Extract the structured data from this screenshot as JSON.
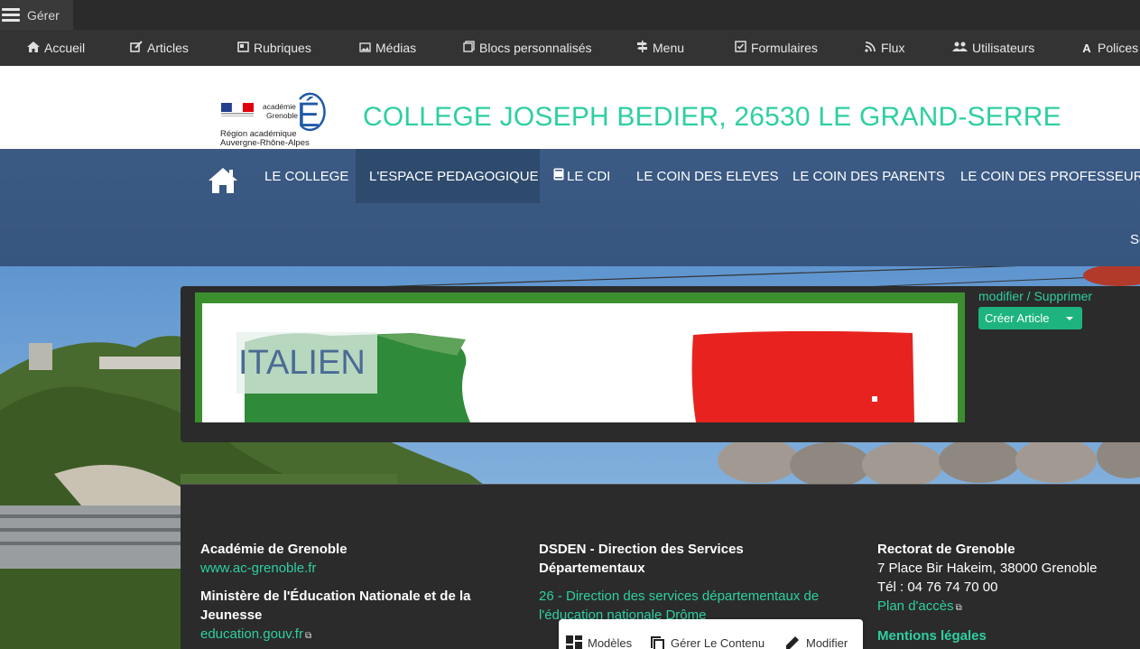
{
  "admin": {
    "gerer": "Gérer",
    "menu": [
      {
        "icon": "home-icon",
        "label": "Accueil"
      },
      {
        "icon": "edit-icon",
        "label": "Articles"
      },
      {
        "icon": "folder-icon",
        "label": "Rubriques"
      },
      {
        "icon": "image-icon",
        "label": "Médias"
      },
      {
        "icon": "blocks-icon",
        "label": "Blocs personnalisés"
      },
      {
        "icon": "signpost-icon",
        "label": "Menu"
      },
      {
        "icon": "checkbox-icon",
        "label": "Formulaires"
      },
      {
        "icon": "rss-icon",
        "label": "Flux"
      },
      {
        "icon": "users-icon",
        "label": "Utilisateurs"
      },
      {
        "icon": "font-icon",
        "label": "Polices"
      }
    ]
  },
  "header": {
    "logo_text": [
      "académie",
      "Grenoble",
      "Région académique",
      "Auvergne-Rhône-Alpes"
    ],
    "title": "COLLEGE JOSEPH BEDIER, 26530 LE GRAND-SERRE"
  },
  "nav": {
    "items": [
      {
        "label": "LE COLLEGE",
        "active": false
      },
      {
        "label": "L'ESPACE PEDAGOGIQUE",
        "active": true
      },
      {
        "label": "LE CDI",
        "active": false,
        "icon": "book-icon"
      },
      {
        "label": "LE COIN DES ELEVES",
        "active": false
      },
      {
        "label": "LE COIN DES PARENTS",
        "active": false
      },
      {
        "label": "LE COIN DES PROFESSEURS",
        "active": false
      }
    ],
    "overflow_text": "Se"
  },
  "article": {
    "title": "ITALIEN",
    "modifier": "modifier",
    "separator": " / ",
    "supprimer": "Supprimer",
    "create_label": "Créer Article"
  },
  "footer": {
    "col1": {
      "heading1": "Académie de Grenoble",
      "link1": "www.ac-grenoble.fr",
      "heading2": "Ministère de l'Éducation Nationale et de la Jeunesse",
      "link2": "education.gouv.fr"
    },
    "col2": {
      "heading": "DSDEN - Direction des Services Départementaux",
      "link": "26 - Direction des services départementaux de l'éducation nationale Drôme"
    },
    "col3": {
      "heading": "Rectorat de Grenoble",
      "address": "7 Place Bir Hakeim, 38000 Grenoble",
      "phone": "Tél :  04 76 74 70 00",
      "plan_link": "Plan d'accès",
      "legal": "Mentions légales"
    }
  },
  "float_toolbar": {
    "modeles": "Modèles",
    "gerer_contenu": "Gérer Le Contenu",
    "modifier": "Modifier"
  },
  "colors": {
    "accent": "#2ecfa1",
    "nav_bg": "#3b5a84",
    "nav_active": "#2e4a6d",
    "admin_bg": "#333333",
    "button_green": "#1db47f"
  }
}
